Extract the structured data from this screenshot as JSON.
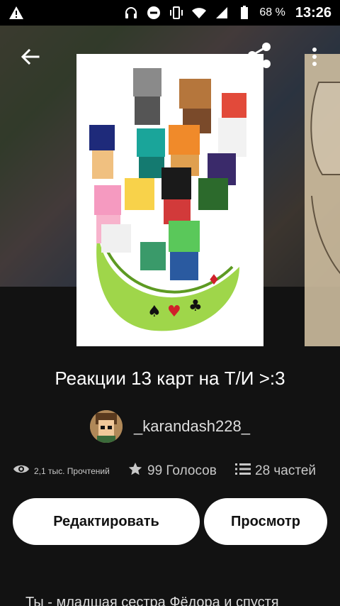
{
  "status_bar": {
    "battery_pct": "68 %",
    "time": "13:26",
    "icons": [
      "warning-icon",
      "headphones-icon",
      "dnd-icon",
      "vibrate-icon",
      "wifi-icon",
      "signal-icon",
      "battery-icon"
    ]
  },
  "toolbar": {
    "icons": [
      "back-arrow-icon",
      "share-icon",
      "more-vertical-icon"
    ]
  },
  "story": {
    "title": "Реакции 13 карт на Т/И >:3",
    "author": "_karandash228_",
    "reads": "2,1 тыс. Прочтений",
    "votes": "99 Голосов",
    "parts": "28 частей",
    "description": "Ты - младшая сестра Фёдора и спустя"
  },
  "actions": {
    "edit_label": "Редактировать",
    "view_label": "Просмотр"
  },
  "colors": {
    "background": "#121212",
    "button_bg": "#ffffff",
    "text_primary": "#ffffff",
    "text_secondary": "#c8c8c8"
  }
}
